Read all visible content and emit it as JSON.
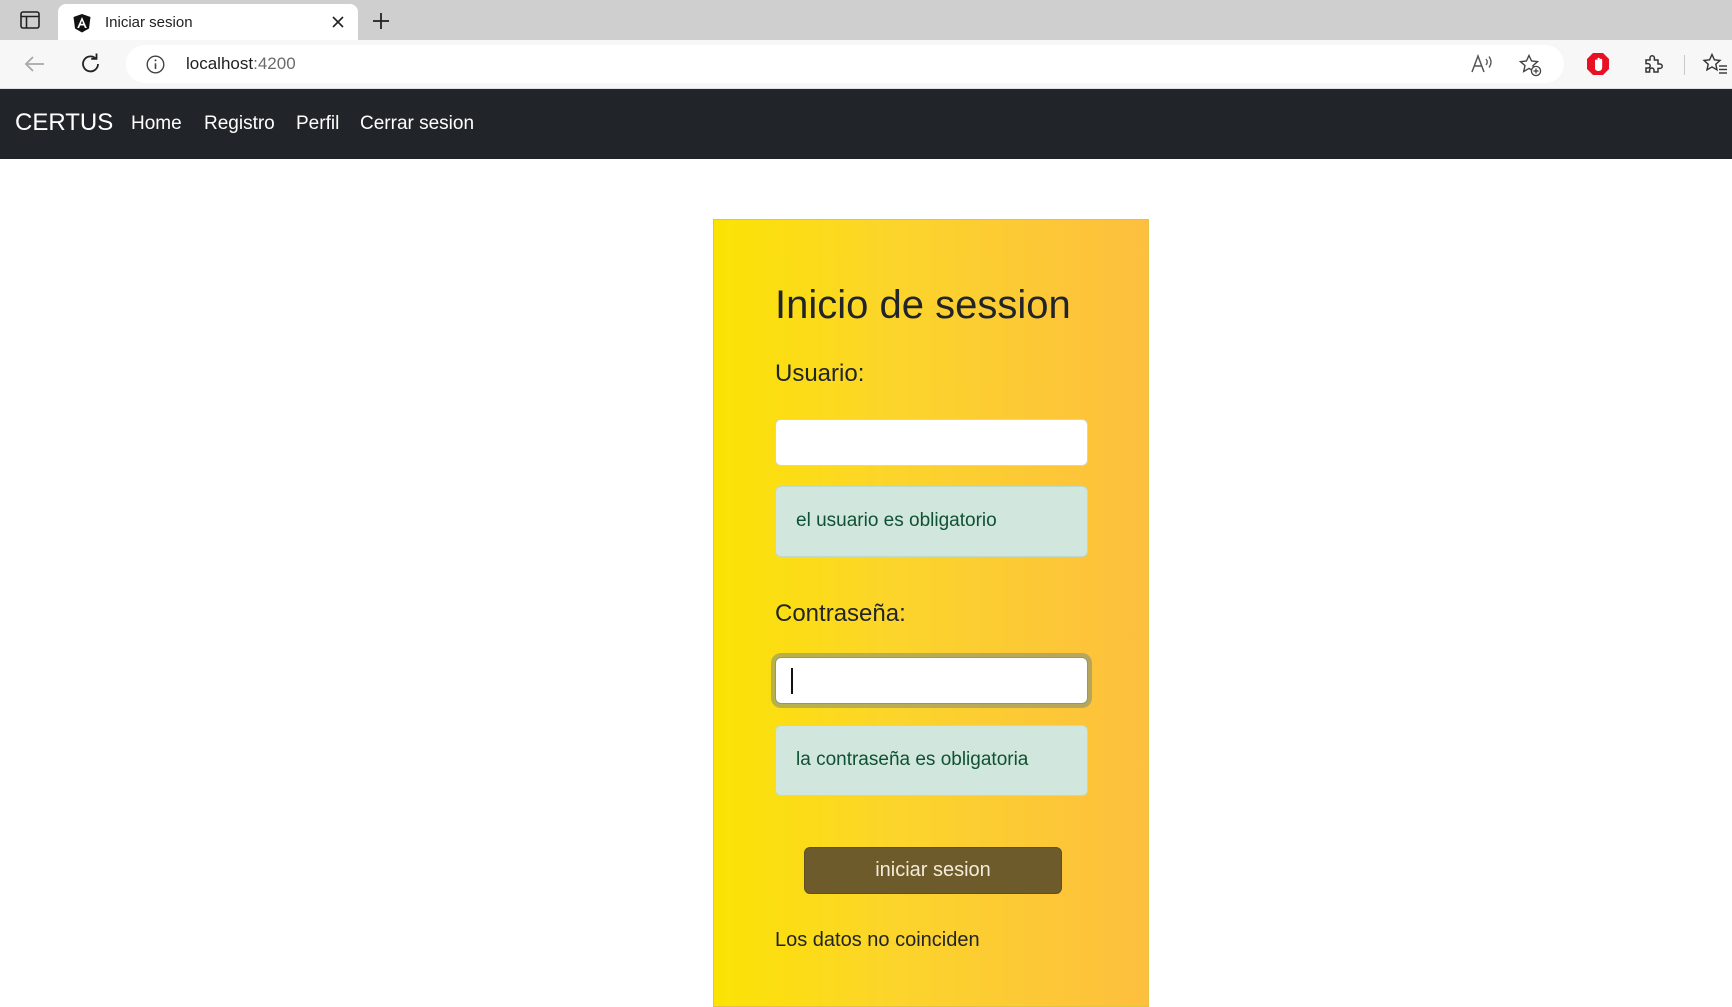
{
  "browser": {
    "tab": {
      "title": "Iniciar sesion",
      "favicon": "angular-icon"
    },
    "address_bar": {
      "host": "localhost",
      "port": ":4200"
    },
    "accent": "#e81123"
  },
  "navbar": {
    "brand": "CERTUS",
    "links": [
      "Home",
      "Registro",
      "Perfil",
      "Cerrar sesion"
    ],
    "background": "#212529"
  },
  "login": {
    "title": "Inicio de session",
    "user_label": "Usuario:",
    "user_value": "",
    "user_error": "el usuario es obligatorio",
    "password_label": "Contraseña:",
    "password_value": "",
    "password_error": "la contraseña es obligatoria",
    "submit_label": "iniciar sesion",
    "status_message": "Los datos no coinciden",
    "gradient": [
      "#fbe304",
      "#fdbf3f"
    ]
  }
}
